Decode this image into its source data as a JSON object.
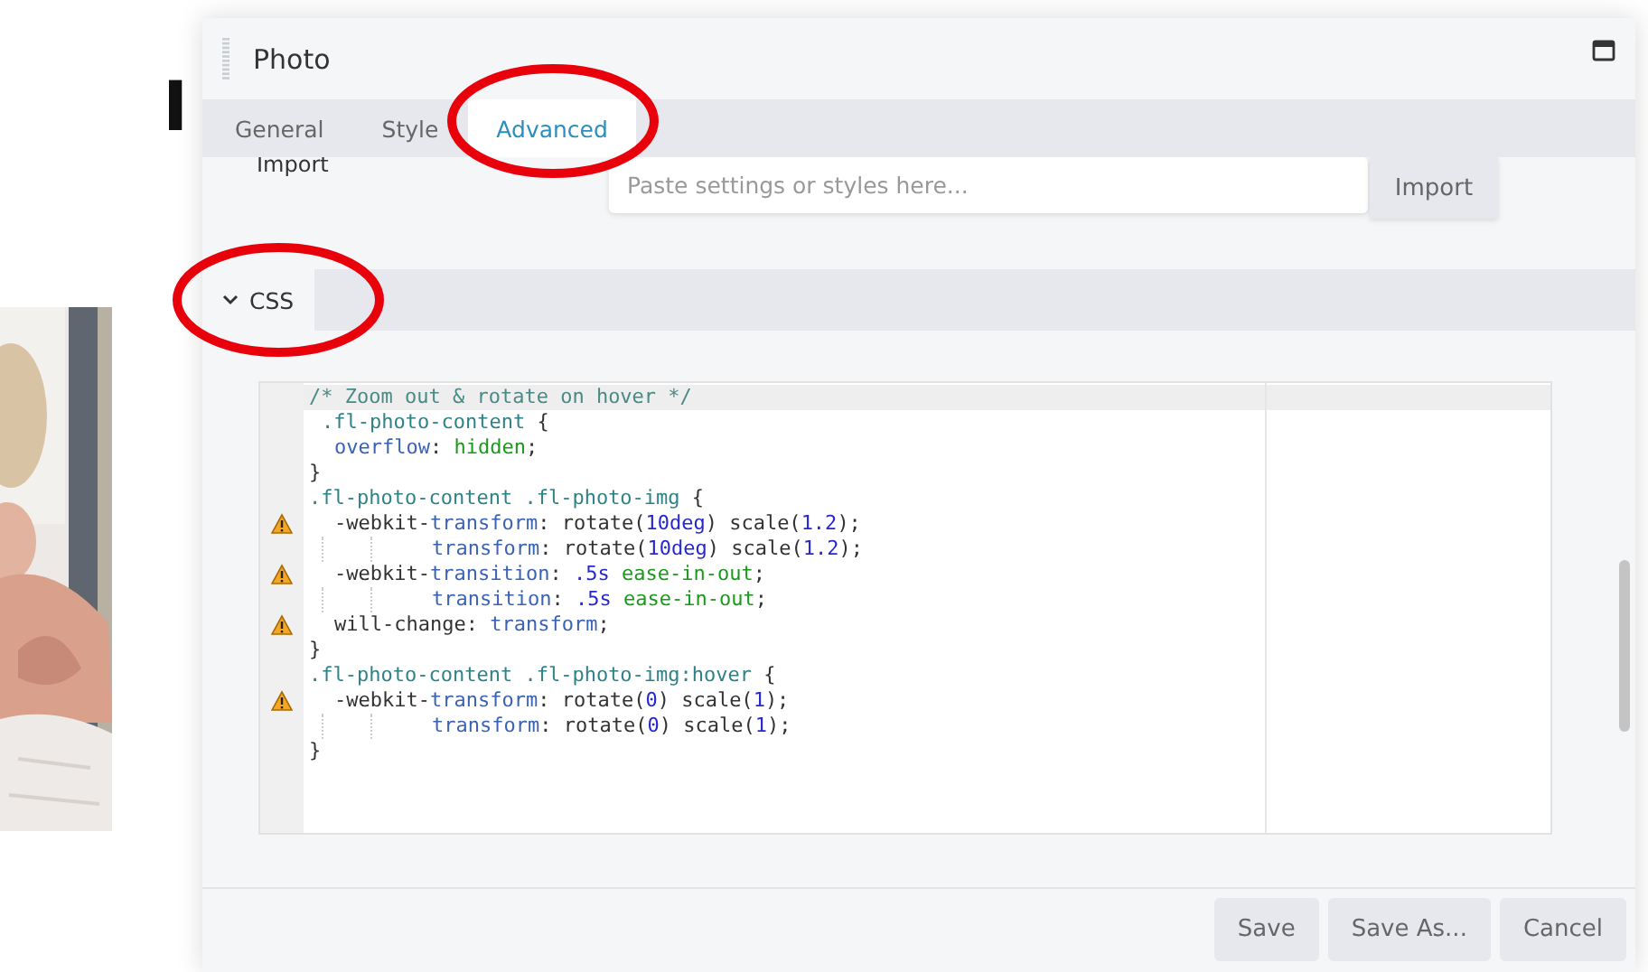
{
  "backdrop": {
    "heading": "I"
  },
  "panel": {
    "title": "Photo",
    "tabs": [
      {
        "label": "General",
        "selected": false,
        "circled": false
      },
      {
        "label": "Style",
        "selected": false,
        "circled": false
      },
      {
        "label": "Advanced",
        "selected": true,
        "circled": true
      }
    ],
    "import": {
      "label": "Import",
      "placeholder": "Paste settings or styles here...",
      "button": "Import"
    },
    "section": {
      "title": "CSS",
      "expanded": true,
      "circled": true
    },
    "editor": {
      "lines": [
        {
          "kind": "rule",
          "warning": false,
          "tokens": [
            {
              "kind": "comment",
              "text": "/* Zoom out & rotate on hover */"
            }
          ]
        },
        {
          "kind": "nested",
          "warning": false,
          "tokens": [
            {
              "kind": "selector",
              "text": ".fl-photo-content"
            },
            {
              "kind": "plain",
              "text": " {"
            }
          ]
        },
        {
          "kind": "declaration",
          "warning": false,
          "tokens": [
            {
              "kind": "prop",
              "text": "overflow"
            },
            {
              "kind": "plain",
              "text": ": "
            },
            {
              "kind": "keyword",
              "text": "hidden"
            },
            {
              "kind": "plain",
              "text": ";"
            }
          ]
        },
        {
          "kind": "rule",
          "warning": false,
          "tokens": [
            {
              "kind": "plain",
              "text": "}"
            }
          ]
        },
        {
          "kind": "rule",
          "warning": false,
          "tokens": [
            {
              "kind": "selector",
              "text": ".fl-photo-content .fl-photo-img"
            },
            {
              "kind": "plain",
              "text": " {"
            }
          ]
        },
        {
          "kind": "declaration",
          "warning": true,
          "tokens": [
            {
              "kind": "plain",
              "text": "-webkit-"
            },
            {
              "kind": "prop",
              "text": "transform"
            },
            {
              "kind": "plain",
              "text": ": rotate("
            },
            {
              "kind": "number",
              "text": "10deg"
            },
            {
              "kind": "plain",
              "text": ") scale("
            },
            {
              "kind": "number",
              "text": "1.2"
            },
            {
              "kind": "plain",
              "text": ");"
            }
          ]
        },
        {
          "kind": "continuation",
          "warning": false,
          "tokens": [
            {
              "kind": "prop",
              "text": "transform"
            },
            {
              "kind": "plain",
              "text": ": rotate("
            },
            {
              "kind": "number",
              "text": "10deg"
            },
            {
              "kind": "plain",
              "text": ") scale("
            },
            {
              "kind": "number",
              "text": "1.2"
            },
            {
              "kind": "plain",
              "text": ");"
            }
          ]
        },
        {
          "kind": "declaration",
          "warning": true,
          "tokens": [
            {
              "kind": "plain",
              "text": "-webkit-"
            },
            {
              "kind": "prop",
              "text": "transition"
            },
            {
              "kind": "plain",
              "text": ": "
            },
            {
              "kind": "number",
              "text": ".5s "
            },
            {
              "kind": "keyword",
              "text": "ease-in-out"
            },
            {
              "kind": "plain",
              "text": ";"
            }
          ]
        },
        {
          "kind": "continuation",
          "warning": false,
          "tokens": [
            {
              "kind": "prop",
              "text": "transition"
            },
            {
              "kind": "plain",
              "text": ": "
            },
            {
              "kind": "number",
              "text": ".5s "
            },
            {
              "kind": "keyword",
              "text": "ease-in-out"
            },
            {
              "kind": "plain",
              "text": ";"
            }
          ]
        },
        {
          "kind": "declaration",
          "warning": true,
          "tokens": [
            {
              "kind": "plain",
              "text": "will-change: "
            },
            {
              "kind": "prop",
              "text": "transform"
            },
            {
              "kind": "plain",
              "text": ";"
            }
          ]
        },
        {
          "kind": "rule",
          "warning": false,
          "tokens": [
            {
              "kind": "plain",
              "text": "}"
            }
          ]
        },
        {
          "kind": "rule",
          "warning": false,
          "tokens": [
            {
              "kind": "selector",
              "text": ".fl-photo-content .fl-photo-img:hover"
            },
            {
              "kind": "plain",
              "text": " {"
            }
          ]
        },
        {
          "kind": "declaration",
          "warning": true,
          "tokens": [
            {
              "kind": "plain",
              "text": "-webkit-"
            },
            {
              "kind": "prop",
              "text": "transform"
            },
            {
              "kind": "plain",
              "text": ": rotate("
            },
            {
              "kind": "number",
              "text": "0"
            },
            {
              "kind": "plain",
              "text": ") scale("
            },
            {
              "kind": "number",
              "text": "1"
            },
            {
              "kind": "plain",
              "text": ");"
            }
          ]
        },
        {
          "kind": "continuation",
          "warning": false,
          "tokens": [
            {
              "kind": "prop",
              "text": "transform"
            },
            {
              "kind": "plain",
              "text": ": rotate("
            },
            {
              "kind": "number",
              "text": "0"
            },
            {
              "kind": "plain",
              "text": ") scale("
            },
            {
              "kind": "number",
              "text": "1"
            },
            {
              "kind": "plain",
              "text": ");"
            }
          ]
        },
        {
          "kind": "rule",
          "warning": false,
          "tokens": [
            {
              "kind": "plain",
              "text": "}"
            }
          ]
        }
      ]
    },
    "buttons": [
      "Save",
      "Save As...",
      "Cancel"
    ]
  }
}
